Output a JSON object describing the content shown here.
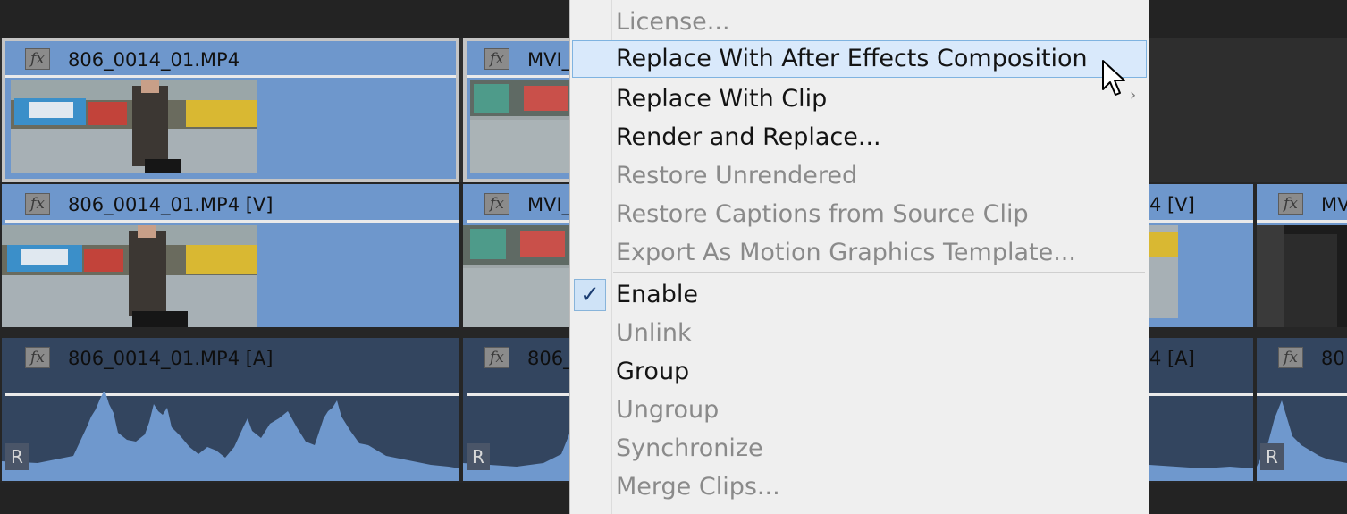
{
  "timeline": {
    "clips": [
      {
        "id": "v2-1",
        "title": "806_0014_01.MP4",
        "kind": "video",
        "fx": "fx"
      },
      {
        "id": "v2-2",
        "title": "MVI_",
        "kind": "video",
        "fx": "fx"
      },
      {
        "id": "v1-1",
        "title": "806_0014_01.MP4 [V]",
        "kind": "video",
        "fx": "fx"
      },
      {
        "id": "v1-2",
        "title": "MVI_",
        "kind": "video",
        "fx": "fx"
      },
      {
        "id": "v1-3",
        "title": "4 [V]",
        "kind": "video"
      },
      {
        "id": "v1-4",
        "title": "MV",
        "kind": "video",
        "fx": "fx"
      },
      {
        "id": "a1-1",
        "title": "806_0014_01.MP4 [A]",
        "kind": "audio",
        "fx": "fx",
        "badge": "R"
      },
      {
        "id": "a1-2",
        "title": "806_",
        "kind": "audio",
        "fx": "fx",
        "badge": "R"
      },
      {
        "id": "a1-3",
        "title": "4 [A]",
        "kind": "audio"
      },
      {
        "id": "a1-4",
        "title": "80",
        "kind": "audio",
        "fx": "fx",
        "badge": "R"
      }
    ]
  },
  "context_menu": {
    "items": [
      {
        "label": "License...",
        "enabled": false
      },
      {
        "label": "Replace With After Effects Composition",
        "enabled": true,
        "highlighted": true
      },
      {
        "label": "Replace With Clip",
        "enabled": true,
        "submenu": true
      },
      {
        "label": "Render and Replace...",
        "enabled": true
      },
      {
        "label": "Restore Unrendered",
        "enabled": false
      },
      {
        "label": "Restore Captions from Source Clip",
        "enabled": false
      },
      {
        "label": "Export As Motion Graphics Template...",
        "enabled": false
      },
      {
        "separator": true
      },
      {
        "label": "Enable",
        "enabled": true,
        "checked": true,
        "check_glyph": "✓"
      },
      {
        "label": "Unlink",
        "enabled": false
      },
      {
        "label": "Group",
        "enabled": true
      },
      {
        "label": "Ungroup",
        "enabled": false
      },
      {
        "label": "Synchronize",
        "enabled": false
      },
      {
        "label": "Merge Clips...",
        "enabled": false
      }
    ],
    "submenu_glyph": "›"
  },
  "colors": {
    "video_clip": "#6e97cc",
    "audio_clip": "#33455f",
    "waveform": "#6f98cd",
    "menu_bg": "#efefef",
    "menu_highlight": "#d9e9fb"
  },
  "icons": {
    "cursor": "arrow-pointer-icon",
    "submenu": "chevron-right-icon",
    "check": "checkmark-icon"
  }
}
